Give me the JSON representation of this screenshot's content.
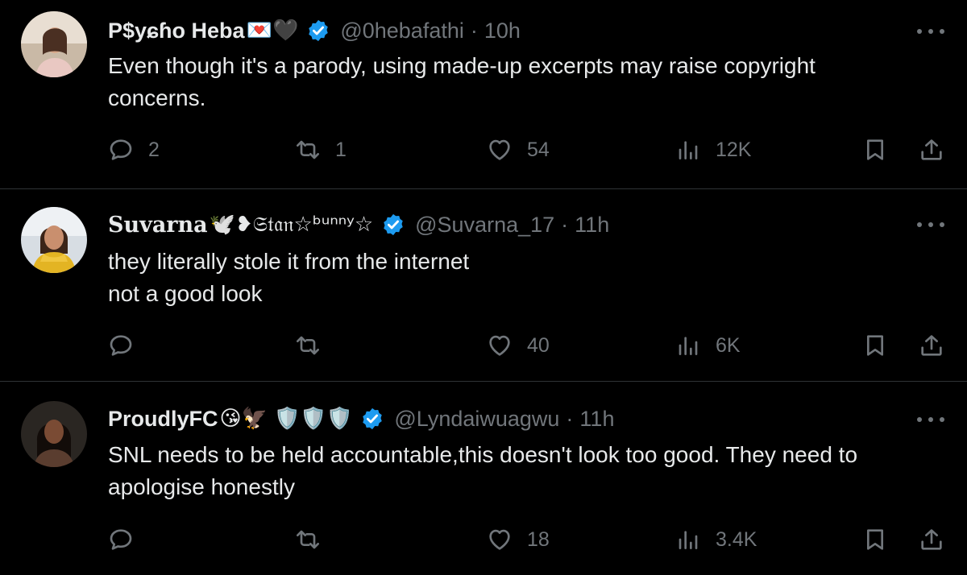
{
  "colors": {
    "background": "#000000",
    "text": "#e7e9ea",
    "secondary": "#71767b",
    "verified": "#1d9bf0",
    "divider": "#2f3336"
  },
  "tweets": [
    {
      "name": "P$yɕɦo Heba",
      "emoji": "💌🖤",
      "handle": "@0hebafathi",
      "time": "10h",
      "text_lines": [
        "Even though it's a parody, using made-up excerpts may raise copyright",
        "concerns."
      ],
      "replies": "2",
      "reposts": "1",
      "likes": "54",
      "views": "12K"
    },
    {
      "name": "Suvarna",
      "emoji": "🕊️❥𝔖𝔱𝔞𝔫☆ᵇᵘⁿⁿʸ☆",
      "handle": "@Suvarna_17",
      "time": "11h",
      "text_lines": [
        "they literally stole it from the internet",
        "not a good look"
      ],
      "replies": "",
      "reposts": "",
      "likes": "40",
      "views": "6K"
    },
    {
      "name": "ProudlyFC",
      "emoji": "😘🦅 🛡️🛡️🛡️",
      "handle": "@Lyndaiwuagwu",
      "time": "11h",
      "text_lines": [
        "SNL needs to be held accountable,this doesn't look too good. They need to",
        "apologise honestly"
      ],
      "replies": "",
      "reposts": "",
      "likes": "18",
      "views": "3.4K"
    }
  ],
  "separator": "·",
  "icons": [
    "reply-icon",
    "repost-icon",
    "like-icon",
    "views-icon",
    "bookmark-icon",
    "share-icon",
    "verified-badge-icon",
    "more-icon"
  ]
}
